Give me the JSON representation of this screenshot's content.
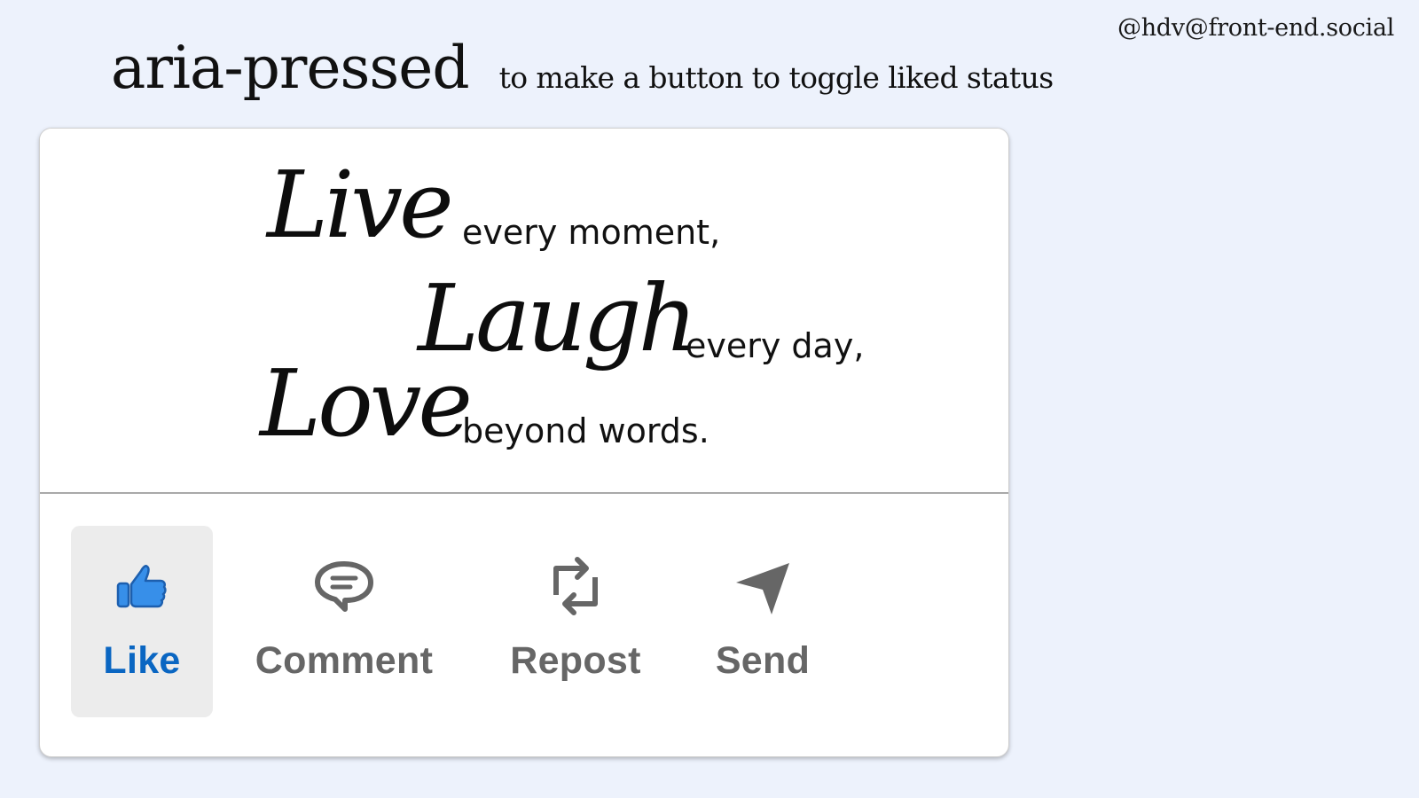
{
  "header": {
    "handle": "@hdv@front-end.social",
    "title": "aria-pressed",
    "subtitle": "to make a button to toggle liked status"
  },
  "quote": {
    "line1_script": "Live",
    "line1_text": "every moment,",
    "line2_script": "Laugh",
    "line2_text": "every day,",
    "line3_script": "Love",
    "line3_text": "beyond words."
  },
  "actions": [
    {
      "label": "Like",
      "icon": "thumbs-up-icon",
      "pressed": true,
      "color": "#0a66c2"
    },
    {
      "label": "Comment",
      "icon": "comment-bubble-icon",
      "pressed": false,
      "color": "#666666"
    },
    {
      "label": "Repost",
      "icon": "repost-arrows-icon",
      "pressed": false,
      "color": "#666666"
    },
    {
      "label": "Send",
      "icon": "paper-plane-icon",
      "pressed": false,
      "color": "#666666"
    }
  ],
  "colors": {
    "background": "#edf2fc",
    "card": "#ffffff",
    "like_active": "#0a66c2",
    "thumb_fill": "#378fe9",
    "pressed_bg": "#ececec"
  }
}
